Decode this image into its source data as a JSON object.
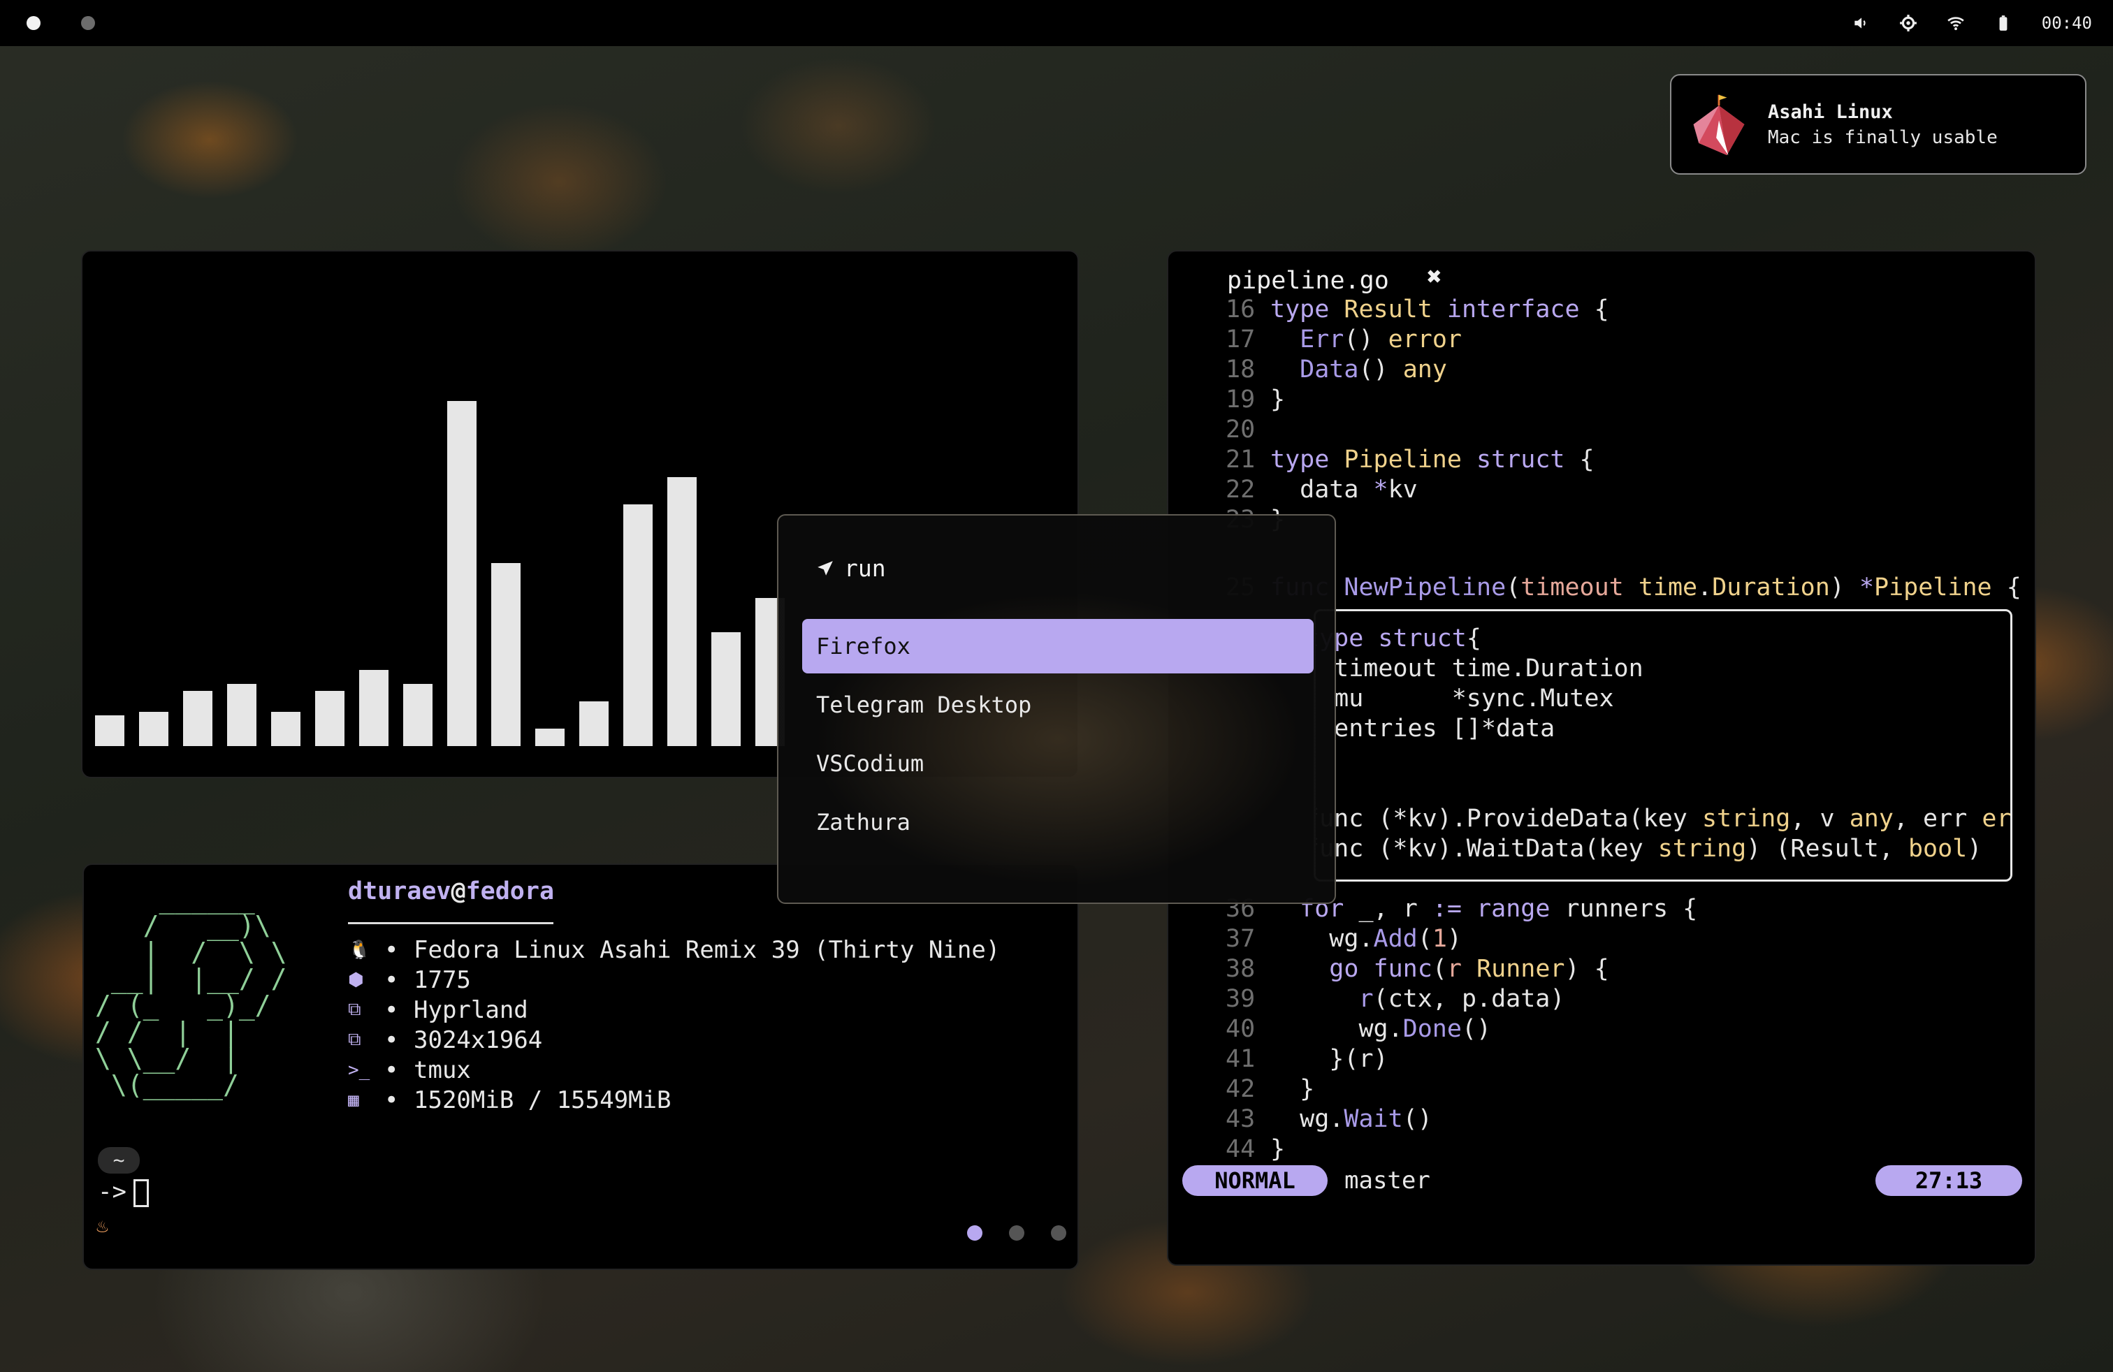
{
  "topbar": {
    "workspaces": [
      {
        "active": true
      },
      {
        "active": false
      }
    ],
    "icons": [
      "volume-icon",
      "gear-icon",
      "wifi-icon",
      "battery-icon"
    ],
    "clock": "00:40"
  },
  "notification": {
    "title": "Asahi Linux",
    "body": "Mac is finally usable"
  },
  "visualizer": {
    "bars": [
      0.09,
      0.1,
      0.16,
      0.18,
      0.1,
      0.16,
      0.22,
      0.18,
      1.0,
      0.53,
      0.05,
      0.13,
      0.7,
      0.78,
      0.33,
      0.43
    ]
  },
  "fetch": {
    "user": "dturaev",
    "host": "fedora",
    "at": "@",
    "lines": [
      {
        "icon": "linux-icon",
        "glyph": "🐧",
        "text": "Fedora Linux Asahi Remix 39 (Thirty Nine)"
      },
      {
        "icon": "package-icon",
        "glyph": "⬢",
        "text": "1775"
      },
      {
        "icon": "window-icon",
        "glyph": "⧉",
        "text": "Hyprland"
      },
      {
        "icon": "display-icon",
        "glyph": "⧉",
        "text": "3024x1964"
      },
      {
        "icon": "terminal-icon",
        "glyph": ">_",
        "text": "tmux"
      },
      {
        "icon": "memory-icon",
        "glyph": "▦",
        "text": "1520MiB / 15549MiB"
      }
    ],
    "bullet": "•",
    "prompt_dir": "~",
    "prompt_arrow": "->",
    "pager": [
      true,
      false,
      false
    ]
  },
  "editor": {
    "filename": "pipeline.go",
    "close": "✖",
    "mode": "NORMAL",
    "branch_icon": "",
    "branch": "master",
    "position": "27:13"
  },
  "launcher": {
    "prompt": "run",
    "items": [
      "Firefox",
      "Telegram Desktop",
      "VSCodium",
      "Zathura"
    ],
    "selected": 0
  },
  "colors": {
    "accent": "#b8a8f0",
    "ascii_logo": "#8fcf98",
    "type": "#f0d28c"
  }
}
